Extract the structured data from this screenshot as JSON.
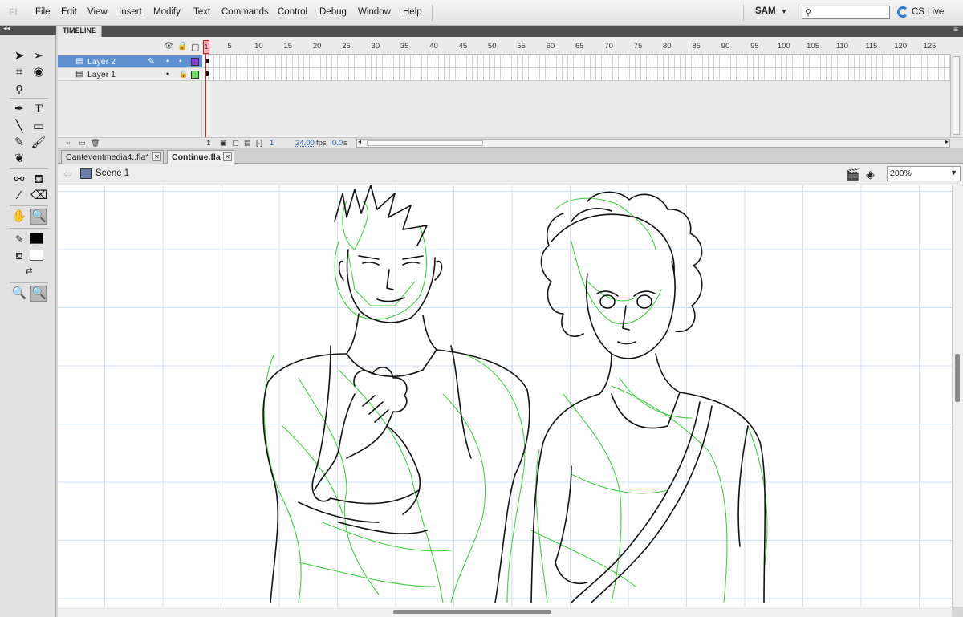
{
  "app": {
    "logo": "Fl"
  },
  "menubar": {
    "items": [
      "File",
      "Edit",
      "View",
      "Insert",
      "Modify",
      "Text",
      "Commands",
      "Control",
      "Debug",
      "Window",
      "Help"
    ],
    "workspace": "SAM",
    "cs_live": "CS Live"
  },
  "tools": {
    "icons": [
      "selection-tool-icon",
      "subselection-tool-icon",
      "free-transform-tool-icon",
      "3d-rotation-tool-icon",
      "lasso-tool-icon",
      "pen-tool-icon",
      "text-tool-icon",
      "line-tool-icon",
      "rectangle-tool-icon",
      "pencil-tool-icon",
      "brush-tool-icon",
      "deco-tool-icon",
      "bone-tool-icon",
      "paint-bucket-tool-icon",
      "eyedropper-tool-icon",
      "eraser-tool-icon",
      "hand-tool-icon",
      "zoom-tool-icon",
      "stroke-color-icon",
      "fill-color-icon",
      "swap-colors-icon",
      "zoom-in-icon",
      "zoom-out-icon"
    ],
    "stroke_color": "#000000",
    "fill_color": "#ffffff"
  },
  "timeline": {
    "tab_label": "TIMELINE",
    "frame_numbers": [
      "1",
      "5",
      "10",
      "15",
      "20",
      "25",
      "30",
      "35",
      "40",
      "45",
      "50",
      "55",
      "60",
      "65",
      "70",
      "75",
      "80",
      "85",
      "90",
      "95",
      "100",
      "105",
      "110",
      "115",
      "120",
      "125"
    ],
    "layers": [
      {
        "name": "Layer 2",
        "selected": true,
        "outline_color": "#8a3fd6"
      },
      {
        "name": "Layer 1",
        "selected": false,
        "outline_color": "#66e06a"
      }
    ],
    "footer": {
      "current_frame": "1",
      "fps_value": "24.00",
      "fps_label": "fps",
      "time_value": "0.0",
      "time_label": "s"
    }
  },
  "document_tabs": [
    {
      "label": "Canteventmedia4..fla*",
      "active": false
    },
    {
      "label": "Continue.fla",
      "active": true
    }
  ],
  "editbar": {
    "scene": "Scene 1",
    "zoom": "200%"
  },
  "stage": {
    "sketch_colors": {
      "lineart": "#111111",
      "rough": "#3fd23f"
    }
  }
}
